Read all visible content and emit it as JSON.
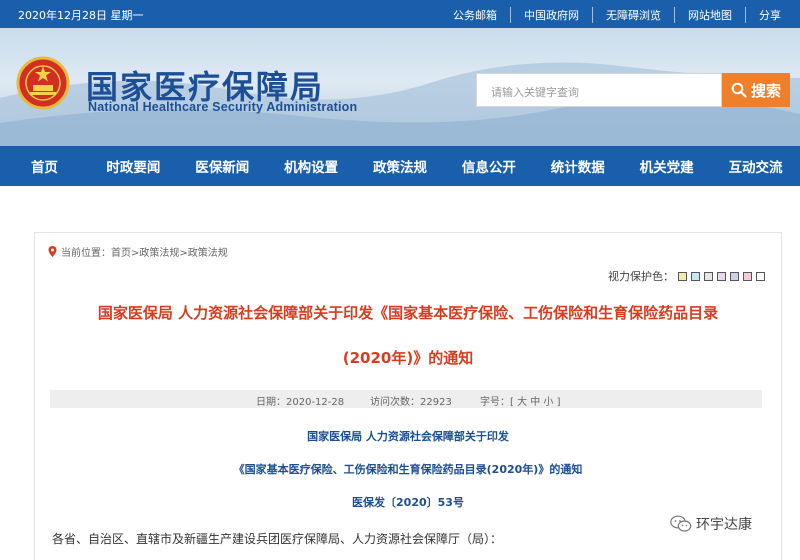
{
  "topbar": {
    "date": "2020年12月28日 星期一",
    "links": [
      "公务邮箱",
      "中国政府网",
      "无障碍浏览",
      "网站地图",
      "分享"
    ]
  },
  "header": {
    "org_cn": "国家医疗保障局",
    "org_en": "National Healthcare Security Administration",
    "search_placeholder": "请输入关键字查询",
    "search_label": "搜索"
  },
  "nav": [
    "首页",
    "时政要闻",
    "医保新闻",
    "机构设置",
    "政策法规",
    "信息公开",
    "统计数据",
    "机关党建",
    "互动交流"
  ],
  "breadcrumb": "当前位置：首页>政策法规>政策法规",
  "vision": {
    "label": "视力保护色：",
    "swatches": [
      "#f5eaa8",
      "#c9e7f0",
      "#e6e6e6",
      "#ead7ee",
      "#cfcfe8",
      "#f4cdd6",
      "#ffffff"
    ]
  },
  "article": {
    "title_line1": "国家医保局 人力资源社会保障部关于印发《国家基本医疗保险、工伤保险和生育保险药品目录",
    "title_line2": "(2020年)》的通知",
    "meta_date": "日期：2020-12-28",
    "meta_views": "访问次数：22923",
    "meta_font": "字号：[ 大 中 小 ]",
    "heading1": "国家医保局  人力资源社会保障部关于印发",
    "heading2": "《国家基本医疗保险、工伤保险和生育保险药品目录(2020年)》的通知",
    "doc_no": "医保发〔2020〕53号",
    "first_para": "各省、自治区、直辖市及新疆生产建设兵团医疗保障局、人力资源社会保障厅（局）："
  },
  "watermark": "环宇达康",
  "colors": {
    "primary_blue": "#1a5fab",
    "search_orange": "#f07f2b",
    "title_red": "#d73c1f",
    "heading_blue": "#1b4e93"
  }
}
